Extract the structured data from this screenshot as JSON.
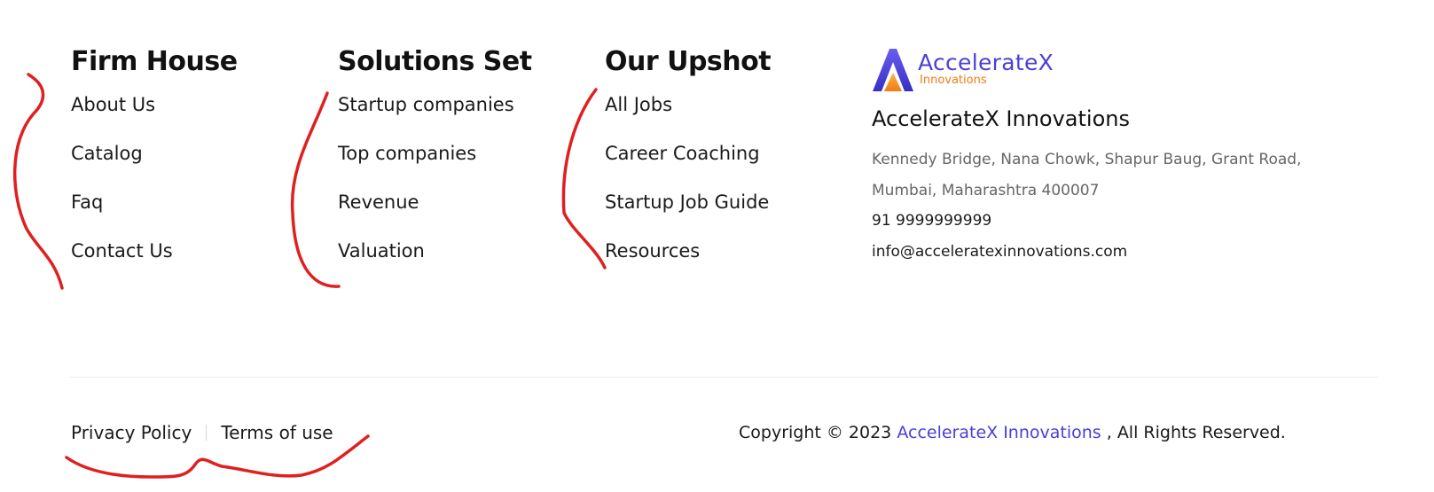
{
  "columns": [
    {
      "title": "Firm House",
      "items": [
        "About Us",
        "Catalog",
        "Faq",
        "Contact Us"
      ]
    },
    {
      "title": "Solutions Set",
      "items": [
        "Startup companies",
        "Top companies",
        "Revenue",
        "Valuation"
      ]
    },
    {
      "title": "Our Upshot",
      "items": [
        "All Jobs",
        "Career Coaching",
        "Startup Job Guide",
        "Resources"
      ]
    }
  ],
  "brand": {
    "logo_name": "AccelerateX",
    "logo_sub": "Innovations",
    "company_name": "AccelerateX Innovations",
    "address": "Kennedy Bridge, Nana Chowk, Shapur Baug, Grant Road, Mumbai, Maharashtra 400007",
    "phone": "91 9999999999",
    "email": "info@acceleratexinnovations.com",
    "colors": {
      "primary": "#4a3fd6",
      "accent": "#f07c16"
    }
  },
  "legal": {
    "privacy": "Privacy Policy",
    "terms": "Terms of use"
  },
  "copyright": {
    "prefix": "Copyright © 2023",
    "company": "AccelerateX Innovations",
    "suffix": ", All Rights Reserved."
  },
  "annotation_color": "#e02020"
}
